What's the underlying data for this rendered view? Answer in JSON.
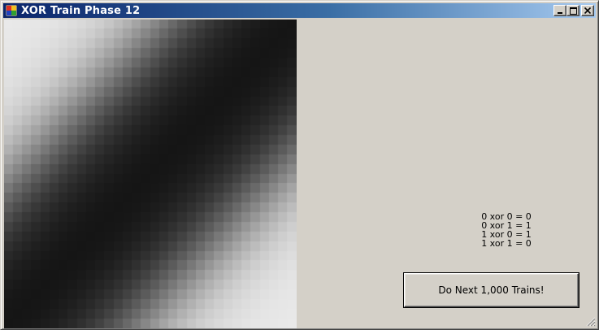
{
  "window": {
    "title": "XOR Train Phase 12",
    "controls": {
      "minimize_icon": "minimize-icon",
      "maximize_icon": "maximize-icon",
      "close_icon": "close-icon"
    }
  },
  "output_map": {
    "description_colors": {
      "dark": "#111111",
      "light": "#ebebeb"
    },
    "grid_cells": 32
  },
  "results": {
    "lines": [
      "0 xor 0 = 0",
      "0 xor 1 = 1",
      "1 xor 0 = 1",
      "1 xor 1 = 0"
    ]
  },
  "actions": {
    "train_button_label": "Do Next 1,000 Trains!"
  },
  "colors": {
    "window_face": "#d4d0c8",
    "title_gradient_start": "#0a246a",
    "title_gradient_end": "#a6caf0"
  }
}
